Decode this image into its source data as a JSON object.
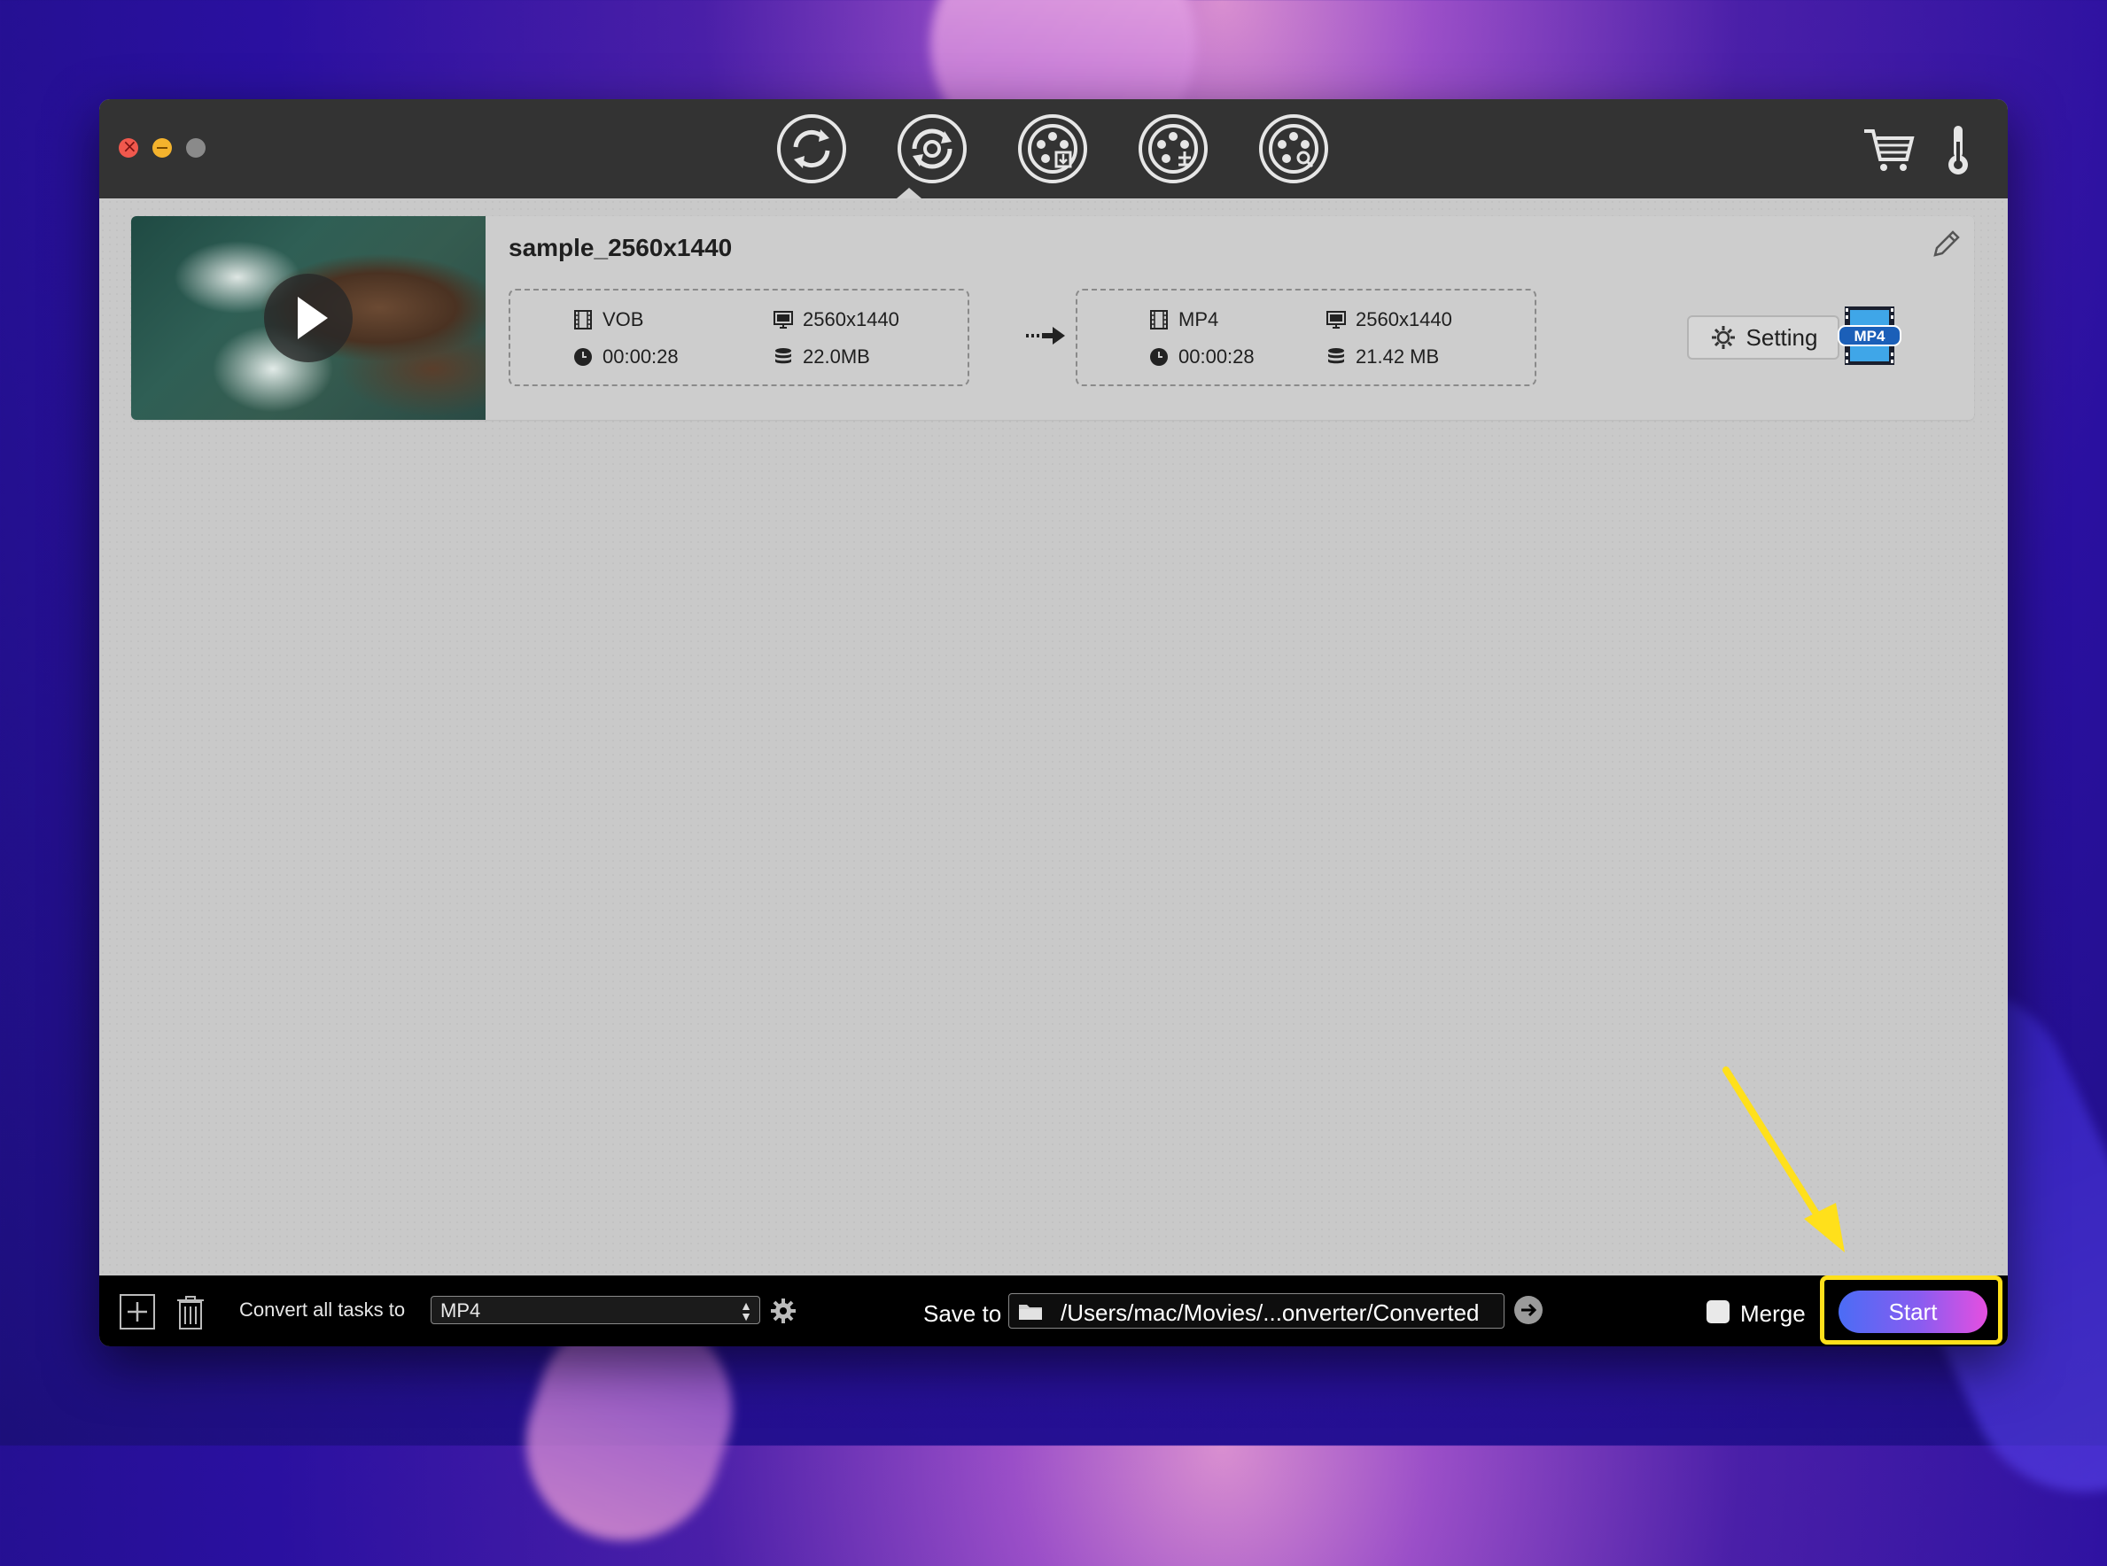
{
  "toolbar": {
    "buttons": [
      {
        "name": "convert",
        "icon": "convert-arrows-icon"
      },
      {
        "name": "rotate",
        "icon": "rotate-icon"
      },
      {
        "name": "download",
        "icon": "film-reel-download-icon"
      },
      {
        "name": "merge",
        "icon": "film-reel-merge-icon"
      },
      {
        "name": "search",
        "icon": "film-reel-search-icon"
      }
    ],
    "right_icons": [
      "cart-icon",
      "thermometer-icon"
    ]
  },
  "task": {
    "title": "sample_2560x1440",
    "source": {
      "format": "VOB",
      "resolution": "2560x1440",
      "duration": "00:00:28",
      "size": "22.0MB"
    },
    "output": {
      "format": "MP4",
      "resolution": "2560x1440",
      "duration": "00:00:28",
      "size": "21.42 MB"
    },
    "setting_label": "Setting",
    "badge_label": "MP4"
  },
  "bottom": {
    "convert_label": "Convert all tasks to",
    "format_value": "MP4",
    "save_label": "Save to",
    "save_path": "/Users/mac/Movies/...onverter/Converted",
    "merge_label": "Merge",
    "start_label": "Start"
  },
  "colors": {
    "titlebar": "#333333",
    "content": "#c9c9c9",
    "bottombar": "#000000",
    "start_gradient_from": "#4b6cf5",
    "start_gradient_to": "#e64fe0",
    "highlight": "#ffe01b"
  }
}
